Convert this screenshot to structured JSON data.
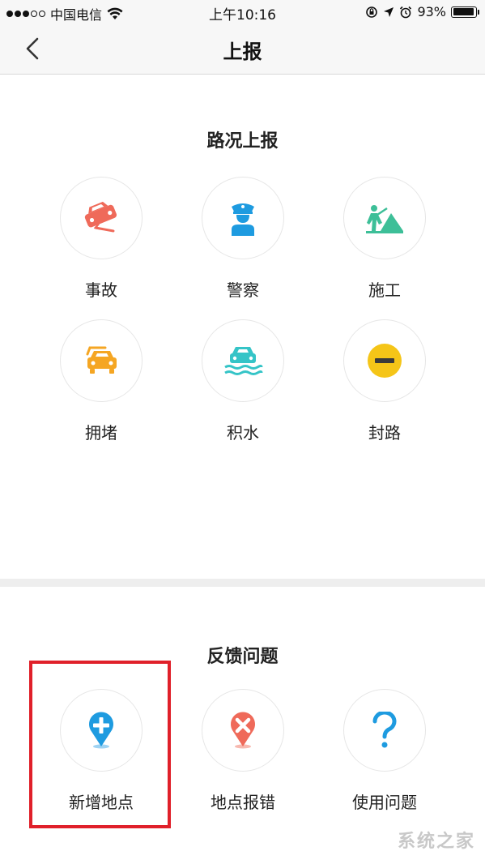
{
  "status_bar": {
    "carrier": "中国电信",
    "time": "上午10:16",
    "battery": "93%",
    "battery_level": 0.93
  },
  "nav": {
    "title": "上报"
  },
  "road_report": {
    "title": "路况上报",
    "items": [
      {
        "label": "事故",
        "icon": "car-accident-icon",
        "color": "#ef6a5a"
      },
      {
        "label": "警察",
        "icon": "police-icon",
        "color": "#1e9be0"
      },
      {
        "label": "施工",
        "icon": "construction-icon",
        "color": "#3dbf98"
      },
      {
        "label": "拥堵",
        "icon": "traffic-jam-icon",
        "color": "#f5a623"
      },
      {
        "label": "积水",
        "icon": "flooding-icon",
        "color": "#35c4c7"
      },
      {
        "label": "封路",
        "icon": "road-closed-icon",
        "color": "#f5c518"
      }
    ]
  },
  "feedback": {
    "title": "反馈问题",
    "items": [
      {
        "label": "新增地点",
        "icon": "add-location-icon",
        "color": "#1e9be0"
      },
      {
        "label": "地点报错",
        "icon": "location-error-icon",
        "color": "#ef6a5a"
      },
      {
        "label": "使用问题",
        "icon": "question-icon",
        "color": "#1e9be0"
      }
    ]
  },
  "highlight_color": "#e0202a",
  "watermark": "系统之家"
}
